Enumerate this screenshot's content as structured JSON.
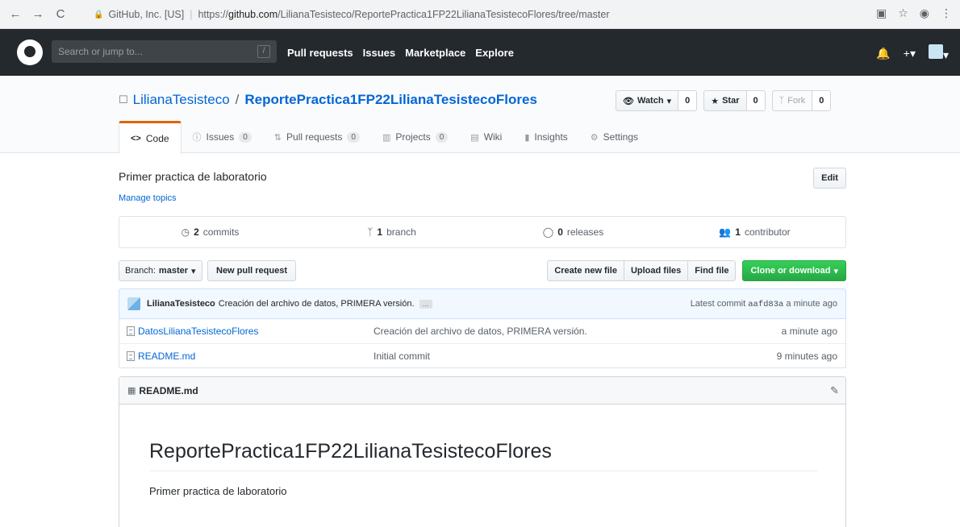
{
  "browser": {
    "back": "←",
    "forward": "→",
    "reload": "C",
    "site_identity": "GitHub, Inc. [US]",
    "url_prefix": "https://",
    "url_host": "github.com",
    "url_path": "/LilianaTesisteco/ReportePractica1FP22LilianaTesistecoFlores/tree/master"
  },
  "header": {
    "search_placeholder": "Search or jump to...",
    "search_key": "/",
    "nav": [
      "Pull requests",
      "Issues",
      "Marketplace",
      "Explore"
    ]
  },
  "repo": {
    "owner": "LilianaTesisteco",
    "separator": "/",
    "name": "ReportePractica1FP22LilianaTesistecoFlores",
    "actions": {
      "watch_label": "Watch",
      "watch_count": "0",
      "star_label": "Star",
      "star_count": "0",
      "fork_label": "Fork",
      "fork_count": "0"
    },
    "tabs": [
      {
        "label": "Code",
        "icon": "<>",
        "counter": ""
      },
      {
        "label": "Issues",
        "icon": "ⓘ",
        "counter": "0"
      },
      {
        "label": "Pull requests",
        "icon": "⇅",
        "counter": "0"
      },
      {
        "label": "Projects",
        "icon": "▥",
        "counter": "0"
      },
      {
        "label": "Wiki",
        "icon": "▤",
        "counter": ""
      },
      {
        "label": "Insights",
        "icon": "▮",
        "counter": ""
      },
      {
        "label": "Settings",
        "icon": "⚙",
        "counter": ""
      }
    ]
  },
  "summary": {
    "description": "Primer practica de laboratorio",
    "manage_topics": "Manage topics",
    "edit": "Edit",
    "numbers": [
      {
        "count": "2",
        "label": "commits"
      },
      {
        "count": "1",
        "label": "branch"
      },
      {
        "count": "0",
        "label": "releases"
      },
      {
        "count": "1",
        "label": "contributor"
      }
    ]
  },
  "file_nav": {
    "branch_prefix": "Branch:",
    "branch_name": "master",
    "new_pull_request": "New pull request",
    "create_new_file": "Create new file",
    "upload_files": "Upload files",
    "find_file": "Find file",
    "clone_or_download": "Clone or download"
  },
  "latest_commit": {
    "author": "LilianaTesisteco",
    "message": "Creación del archivo de datos, PRIMERA versión.",
    "ellipsis": "…",
    "label": "Latest commit",
    "sha": "aafd83a",
    "age": "a minute ago"
  },
  "files": [
    {
      "name": "DatosLilianaTesistecoFlores",
      "message": "Creación del archivo de datos, PRIMERA versión.",
      "age": "a minute ago"
    },
    {
      "name": "README.md",
      "message": "Initial commit",
      "age": "9 minutes ago"
    }
  ],
  "readme": {
    "file": "README.md",
    "heading": "ReportePractica1FP22LilianaTesistecoFlores",
    "body": "Primer practica de laboratorio"
  },
  "colors": {
    "header_bg": "#24292e",
    "link": "#0366d6",
    "clone_green": "#28a745",
    "tab_accent": "#e36209"
  }
}
